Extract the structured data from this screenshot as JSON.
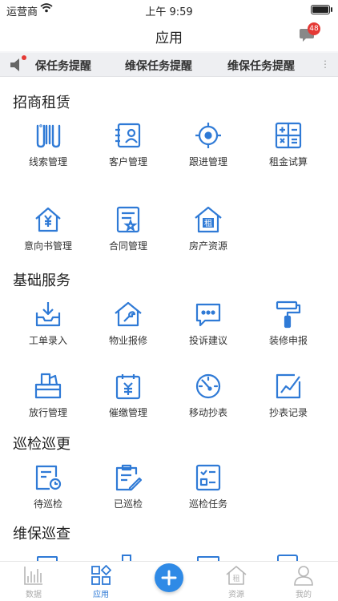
{
  "status": {
    "carrier": "运营商",
    "time": "上午 9:59"
  },
  "nav": {
    "title": "应用",
    "badge": "48"
  },
  "notice": {
    "items": [
      "保任务提醒",
      "维保任务提醒",
      "维保任务提醒"
    ]
  },
  "sections": {
    "s1": {
      "title": "招商租赁",
      "items": [
        "线索管理",
        "客户管理",
        "跟进管理",
        "租金试算",
        "意向书管理",
        "合同管理",
        "房产资源"
      ]
    },
    "s2": {
      "title": "基础服务",
      "items": [
        "工单录入",
        "物业报修",
        "投诉建议",
        "装修申报",
        "放行管理",
        "催缴管理",
        "移动抄表",
        "抄表记录"
      ]
    },
    "s3": {
      "title": "巡检巡更",
      "items": [
        "待巡检",
        "已巡检",
        "巡检任务"
      ]
    },
    "s4": {
      "title": "维保巡查"
    }
  },
  "tabs": {
    "t1": "数据",
    "t2": "应用",
    "t3": "资源",
    "t4": "我的"
  },
  "colors": {
    "accent": "#2f7ad6",
    "badge": "#e53935"
  }
}
